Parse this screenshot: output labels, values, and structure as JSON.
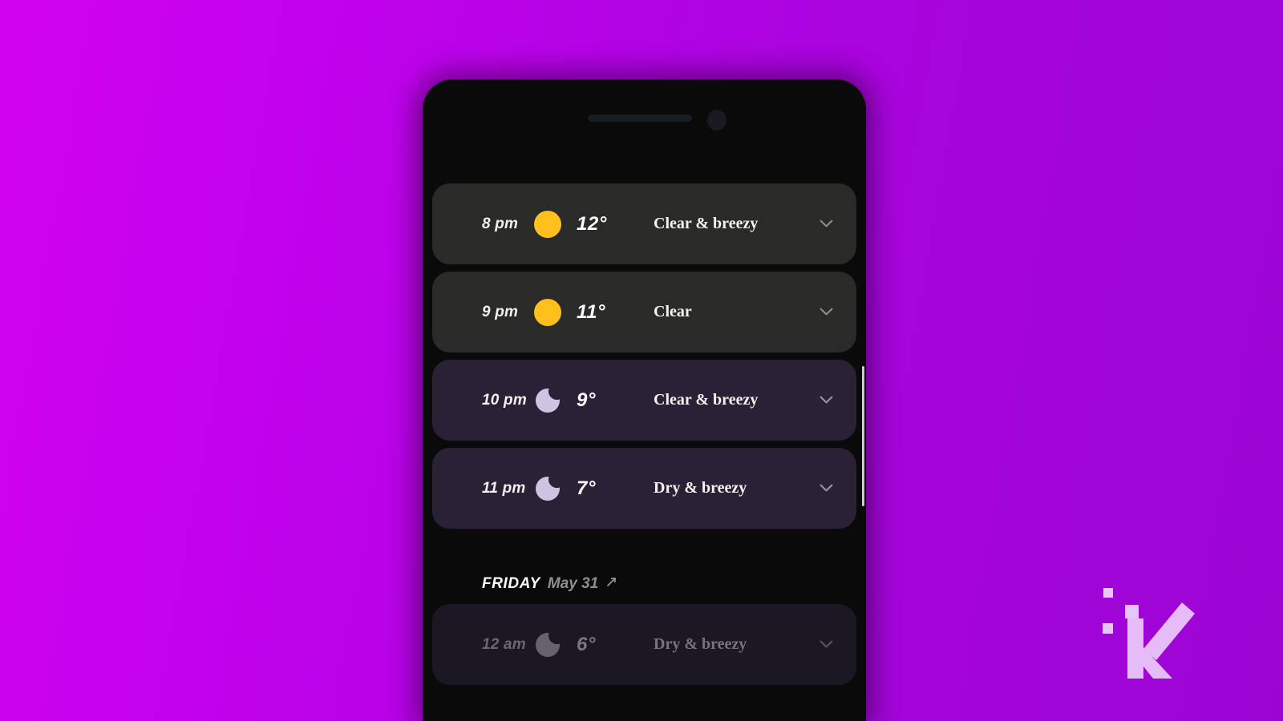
{
  "background": {
    "gradient_from": "#d102ef",
    "gradient_to": "#9b05d4"
  },
  "phone": {
    "frame_color": "#0a0a0a",
    "speaker_name": "speaker-grill",
    "camera_name": "front-camera"
  },
  "app": {
    "type": "hourly-weather-forecast",
    "temperature_unit": "°",
    "card_color_day": "#2a2a28",
    "card_color_night": "#2b2136",
    "sun_color": "#ffc01e",
    "moon_color": "#cfc3e2"
  },
  "hours": [
    {
      "time": "8 pm",
      "icon": "sun-icon",
      "temp": "12°",
      "condition": "Clear & breezy",
      "expand": "chevron-down-icon",
      "theme": "day"
    },
    {
      "time": "9 pm",
      "icon": "sun-icon",
      "temp": "11°",
      "condition": "Clear",
      "expand": "chevron-down-icon",
      "theme": "day"
    },
    {
      "time": "10 pm",
      "icon": "moon-icon",
      "temp": "9°",
      "condition": "Clear & breezy",
      "expand": "chevron-down-icon",
      "theme": "night"
    },
    {
      "time": "11 pm",
      "icon": "moon-icon",
      "temp": "7°",
      "condition": "Dry & breezy",
      "expand": "chevron-down-icon",
      "theme": "night"
    }
  ],
  "day_divider": {
    "day": "FRIDAY",
    "date": "May 31",
    "icon": "expand-arrow-icon"
  },
  "next_day_hours": [
    {
      "time": "12 am",
      "icon": "moon-icon",
      "temp": "6°",
      "condition": "Dry & breezy",
      "expand": "chevron-down-icon",
      "theme": "dim"
    }
  ],
  "logo": {
    "name": "knowtechie-logo",
    "letter": "K",
    "color": "#e3b7f5"
  }
}
